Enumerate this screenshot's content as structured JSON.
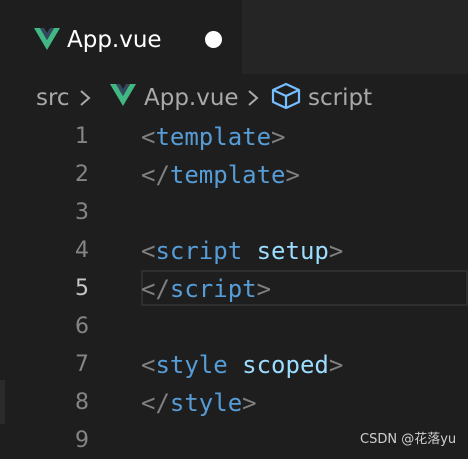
{
  "tab": {
    "title": "App.vue",
    "icon": "vue-icon",
    "modified_indicator": "dot"
  },
  "breadcrumb": {
    "items": [
      "src",
      "App.vue",
      "script"
    ],
    "icons": [
      "",
      "vue-icon",
      "symbol-cube-icon"
    ]
  },
  "editor": {
    "current_line": 5,
    "lines": [
      {
        "number": "1",
        "open": "<",
        "tag": "template",
        "attr": "",
        "close": ">"
      },
      {
        "number": "2",
        "open": "</",
        "tag": "template",
        "attr": "",
        "close": ">"
      },
      {
        "number": "3",
        "open": "",
        "tag": "",
        "attr": "",
        "close": ""
      },
      {
        "number": "4",
        "open": "<",
        "tag": "script",
        "attr": " setup",
        "close": ">"
      },
      {
        "number": "5",
        "open": "</",
        "tag": "script",
        "attr": "",
        "close": ">"
      },
      {
        "number": "6",
        "open": "",
        "tag": "",
        "attr": "",
        "close": ""
      },
      {
        "number": "7",
        "open": "<",
        "tag": "style",
        "attr": " scoped",
        "close": ">"
      },
      {
        "number": "8",
        "open": "</",
        "tag": "style",
        "attr": "",
        "close": ">"
      },
      {
        "number": "9",
        "open": "",
        "tag": "",
        "attr": "",
        "close": ""
      }
    ]
  },
  "watermark": "CSDN @花落yu",
  "colors": {
    "background": "#1e1e1e",
    "tabbar": "#252526",
    "vue_green_light": "#41b883",
    "vue_green_dark": "#34495e",
    "tag": "#569cd6",
    "attribute": "#9cdcfe",
    "punctuation": "#808080",
    "line_number": "#858585",
    "active_line_number": "#c6c6c6",
    "cube_icon": "#75beff"
  }
}
